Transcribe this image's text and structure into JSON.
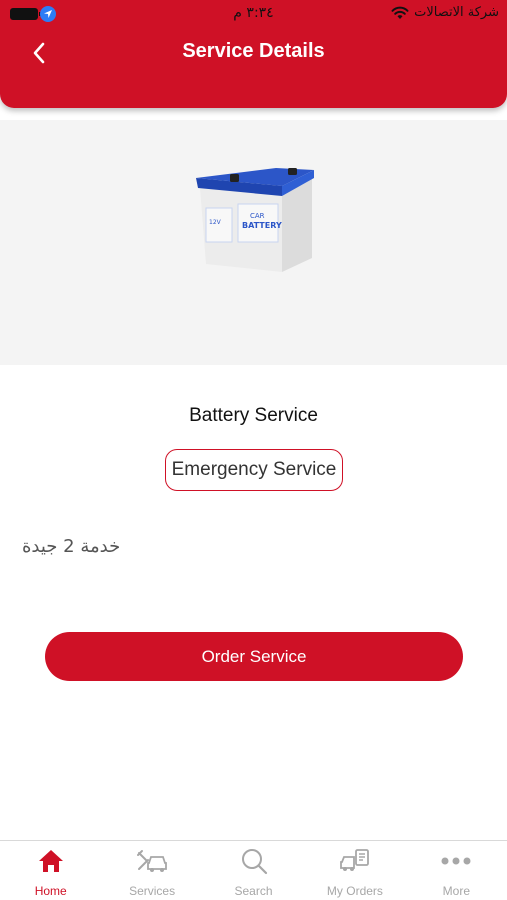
{
  "status_bar": {
    "time": "٣:٣٤ م",
    "carrier": "شركة الاتصالات"
  },
  "header": {
    "title": "Service Details"
  },
  "service": {
    "name": "Battery Service",
    "badge": "Emergency Service",
    "description": "خدمة 2 جيدة",
    "order_button": "Order Service"
  },
  "product_image_text": [
    "CAR",
    "BATTERY",
    "12V"
  ],
  "tabbar": {
    "items": [
      {
        "label": "Home",
        "icon": "home-icon",
        "active": true
      },
      {
        "label": "Services",
        "icon": "services-icon",
        "active": false
      },
      {
        "label": "Search",
        "icon": "search-icon",
        "active": false
      },
      {
        "label": "My Orders",
        "icon": "orders-icon",
        "active": false
      },
      {
        "label": "More",
        "icon": "more-icon",
        "active": false
      }
    ]
  },
  "colors": {
    "brand": "#cf1126",
    "tab_inactive": "#a7a7a7",
    "image_bg": "#f4f4f4"
  }
}
